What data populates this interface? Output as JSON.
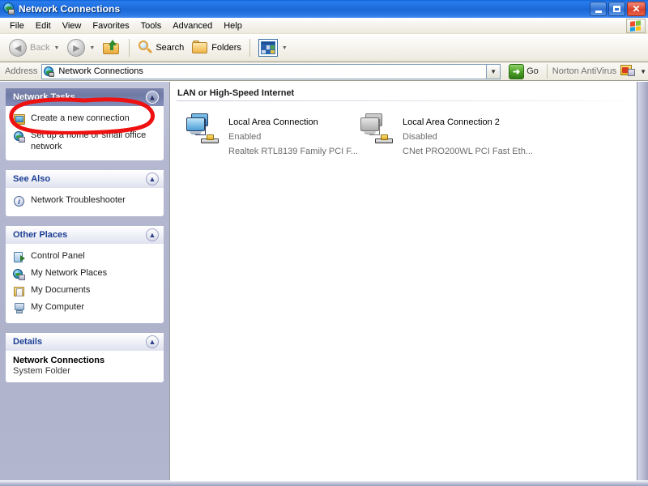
{
  "window": {
    "title": "Network Connections",
    "icon": "network-globe-icon",
    "buttons": {
      "minimize": "_",
      "maximize": "❐",
      "close": "✕"
    }
  },
  "menu": {
    "items": [
      "File",
      "Edit",
      "View",
      "Favorites",
      "Tools",
      "Advanced",
      "Help"
    ],
    "flag_icon": "windows-flag-icon"
  },
  "toolbar": {
    "back_label": "Back",
    "back_icon": "back-arrow-icon",
    "forward_icon": "forward-arrow-icon",
    "up_label": "",
    "up_icon": "folder-up-icon",
    "search_label": "Search",
    "search_icon": "magnifier-icon",
    "folders_label": "Folders",
    "folders_icon": "folder-icon",
    "views_icon": "views-grid-icon",
    "caret": "▼"
  },
  "address": {
    "label": "Address",
    "value": "Network Connections",
    "placeholder": "Network Connections",
    "icon": "network-globe-icon",
    "dropdown_icon": "chevron-down-icon",
    "go_label": "Go",
    "go_icon": "go-arrow-icon",
    "antivirus_label": "Norton AntiVirus",
    "antivirus_icon": "norton-antivirus-icon",
    "antivirus_caret": "▼"
  },
  "sidebar": {
    "panels": [
      {
        "title": "Network Tasks",
        "style": "blue",
        "chevron": "⌃⌃",
        "items": [
          {
            "label": "Create a new connection",
            "icon": "new-connection-icon",
            "highlighted": true
          },
          {
            "label": "Set up a home or small office network",
            "icon": "home-network-icon",
            "highlighted": false
          }
        ]
      },
      {
        "title": "See Also",
        "style": "light",
        "chevron": "⌃⌃",
        "items": [
          {
            "label": "Network Troubleshooter",
            "icon": "info-icon",
            "highlighted": false
          }
        ]
      },
      {
        "title": "Other Places",
        "style": "light",
        "chevron": "⌃⌃",
        "items": [
          {
            "label": "Control Panel",
            "icon": "control-panel-icon",
            "highlighted": false
          },
          {
            "label": "My Network Places",
            "icon": "my-network-places-icon",
            "highlighted": false
          },
          {
            "label": "My Documents",
            "icon": "my-documents-icon",
            "highlighted": false
          },
          {
            "label": "My Computer",
            "icon": "my-computer-icon",
            "highlighted": false
          }
        ]
      },
      {
        "title": "Details",
        "style": "light",
        "chevron": "⌃⌃",
        "details_title": "Network Connections",
        "details_subtitle": "System Folder"
      }
    ]
  },
  "content": {
    "group_header": "LAN or High-Speed Internet",
    "connections": [
      {
        "name": "Local Area Connection",
        "status": "Enabled",
        "device": "Realtek RTL8139 Family PCI F...",
        "state": "enabled",
        "icon": "network-connection-icon"
      },
      {
        "name": "Local Area Connection 2",
        "status": "Disabled",
        "device": "CNet PRO200WL PCI Fast Eth...",
        "state": "disabled",
        "icon": "network-connection-disabled-icon"
      }
    ]
  },
  "annotation": {
    "type": "hand-drawn-red-ellipse",
    "target": "Create a new connection",
    "color": "#ee1111"
  }
}
